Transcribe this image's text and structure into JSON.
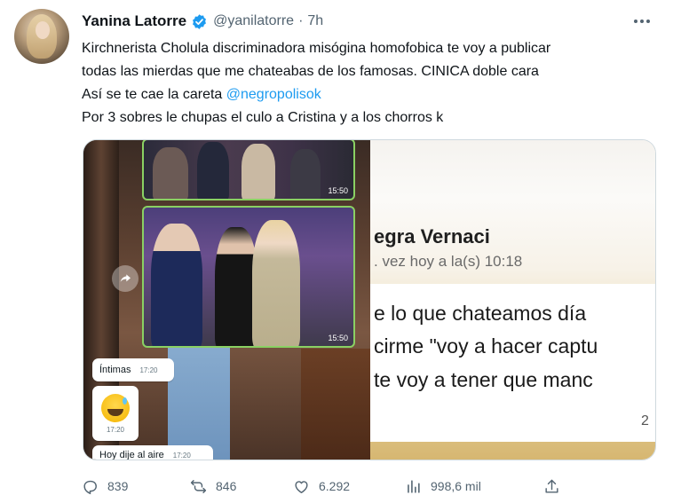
{
  "author": {
    "name": "Yanina Latorre",
    "handle": "@yanilatorre",
    "separator": "·",
    "time": "7h",
    "verified": true
  },
  "tweet": {
    "line1": "Kirchnerista Cholula discriminadora misógina homofobica te voy a publicar",
    "line2": "todas las mierdas que me chateabas de los famosas. CINICA doble cara",
    "line3_prefix": "Así se te cae la careta ",
    "line3_mention": "@negropolisok",
    "line4": "Por 3 sobres le chupas el culo a Cristina y a los chorros k"
  },
  "media": {
    "left": {
      "stamp_top": "15:50",
      "stamp_main": "15:50",
      "bubble1_text": "Íntimas",
      "bubble1_time": "17:20",
      "bubble2_time": "17:20",
      "bubble3_text": "Hoy dije al aire",
      "bubble3_time": "17:20"
    },
    "right": {
      "contact_name": "egra Vernaci",
      "last_seen": ". vez hoy a la(s) 10:18",
      "quote_line1": "e lo que chateamos día",
      "quote_line2": "cirme \"voy a hacer captu",
      "quote_line3": "te voy a tener que manc",
      "quote_num": "2"
    }
  },
  "actions": {
    "replies": "839",
    "retweets": "846",
    "likes": "6.292",
    "views": "998,6 mil"
  },
  "colors": {
    "accent": "#1d9bf0",
    "muted": "#536471",
    "text": "#0f1419",
    "frame": "#8ad163"
  },
  "icons": [
    "verified-badge-icon",
    "more-icon",
    "share-overlay-icon",
    "reply-icon",
    "retweet-icon",
    "like-icon",
    "views-icon",
    "share-icon"
  ]
}
